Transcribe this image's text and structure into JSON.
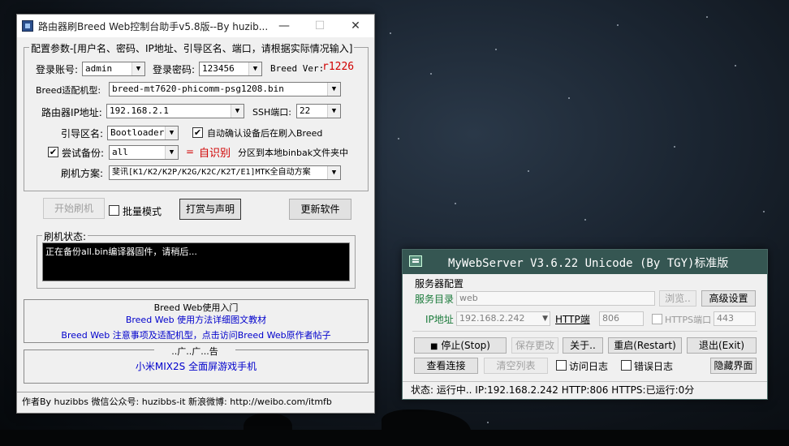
{
  "app1": {
    "title": "路由器刷Breed Web控制台助手v5.8版--By huzib...",
    "window_controls": {
      "minimize": "—",
      "maximize": "☐",
      "close": "✕"
    },
    "config_group_label": "配置参数-[用户名、密码、IP地址、引导区名、端口，请根据实际情况输入]",
    "login_account": {
      "label": "登录账号:",
      "value": "admin"
    },
    "login_password": {
      "label": "登录密码:",
      "value": "123456"
    },
    "breed_ver": {
      "label": "Breed Ver:",
      "value": "r1226"
    },
    "breed_model": {
      "label": "Breed适配机型:",
      "value": "breed-mt7620-phicomm-psg1208.bin"
    },
    "router_ip": {
      "label": "路由器IP地址:",
      "value": "192.168.2.1"
    },
    "ssh_port": {
      "label": "SSH端口:",
      "value": "22"
    },
    "boot_partition": {
      "label": "引导区名:",
      "value": "Bootloader"
    },
    "auto_confirm": {
      "label": "自动确认设备后在刷入Breed",
      "checked": true
    },
    "try_backup": {
      "label": "尝试备份:",
      "checked": true,
      "value": "all"
    },
    "auto_identify": {
      "eq": "=",
      "text": "自识别",
      "suffix": "分区到本地binbak文件夹中"
    },
    "flash_scheme": {
      "label": "刷机方案:",
      "value": "斐讯[K1/K2/K2P/K2G/K2C/K2T/E1]MTK全自动方案"
    },
    "buttons": {
      "start_flash": "开始刷机",
      "batch_mode": "批量模式",
      "batch_checked": false,
      "reward": "打赏与声明",
      "update": "更新软件"
    },
    "flash_status": {
      "label": "刷机状态:",
      "text": "正在备份all.bin编译器固件，请稍后..."
    },
    "intro": {
      "title": "Breed Web使用入门",
      "link1": "Breed Web 使用方法详细图文教材",
      "link2": "Breed Web 注意事项及适配机型，点击访问Breed Web原作者帖子"
    },
    "ads": {
      "title": "..广..广...告",
      "link": "小米MIX2S 全面屏游戏手机"
    },
    "status_bar": "作者By huzibbs 微信公众号: huzibbs-it 新浪微博: http://weibo.com/itmfb"
  },
  "app2": {
    "title": "MyWebServer V3.6.22 Unicode (By TGY)标准版",
    "section": "服务器配置",
    "service_dir": {
      "label": "服务目录",
      "value": "web",
      "browse": "浏览.."
    },
    "advanced": "高级设置",
    "ip": {
      "label": "IP地址",
      "value": "192.168.2.242"
    },
    "http_port": {
      "label": "HTTP端",
      "value": "806"
    },
    "https_port": {
      "label": "HTTPS端口",
      "value": "443",
      "checked": false
    },
    "buttons": {
      "stop": "停止(Stop)",
      "stop_icon": "■",
      "save": "保存更改",
      "about": "关于..",
      "restart": "重启(Restart)",
      "exit": "退出(Exit)",
      "view_conn": "查看连接",
      "clear": "清空列表",
      "access_log": "访问日志",
      "error_log": "错误日志",
      "hide": "隐藏界面"
    },
    "status": "状态: 运行中.. IP:192.168.2.242 HTTP:806 HTTPS:已运行:0分"
  },
  "colors": {
    "titlebar2": "#355652",
    "link": "#0000cc",
    "accent_red": "#d00000"
  }
}
